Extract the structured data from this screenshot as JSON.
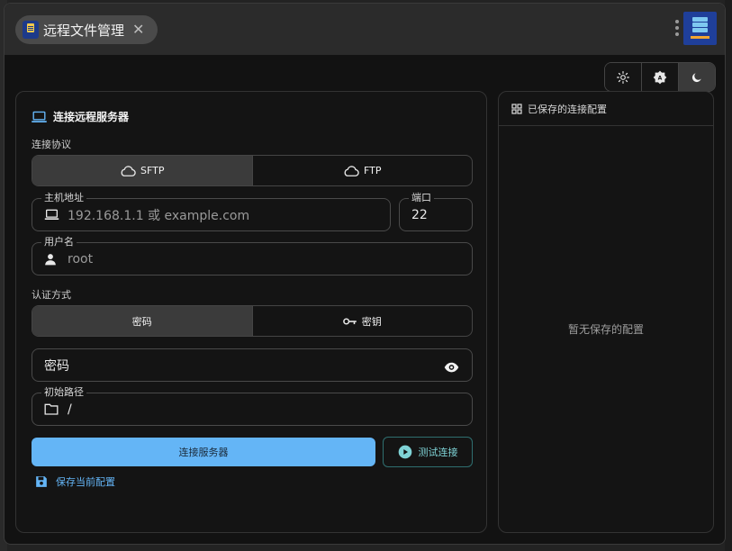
{
  "window": {
    "title": "远程文件管理"
  },
  "theme": {
    "options": [
      "light-mode-icon",
      "auto-mode-icon",
      "dark-mode-icon"
    ],
    "selected": "dark"
  },
  "connect": {
    "section_title": "连接远程服务器",
    "protocol_label": "连接协议",
    "protocols": [
      {
        "label": "SFTP",
        "active": true
      },
      {
        "label": "FTP",
        "active": false
      }
    ],
    "host": {
      "label": "主机地址",
      "placeholder": "192.168.1.1 或 example.com",
      "value": ""
    },
    "port": {
      "label": "端口",
      "value": "22"
    },
    "username": {
      "label": "用户名",
      "placeholder": "root",
      "value": ""
    },
    "auth_label": "认证方式",
    "auth_methods": [
      {
        "label": "密码",
        "active": true
      },
      {
        "label": "密钥",
        "active": false
      }
    ],
    "password": {
      "placeholder": "密码",
      "value": ""
    },
    "initial_path": {
      "label": "初始路径",
      "value": "/"
    },
    "connect_button": "连接服务器",
    "test_button": "测试连接",
    "save_link": "保存当前配置"
  },
  "saved": {
    "title": "已保存的连接配置",
    "empty_text": "暂无保存的配置"
  },
  "colors": {
    "primary": "#64b5f6",
    "accent_teal": "#7fd3d6",
    "background": "#121212"
  }
}
